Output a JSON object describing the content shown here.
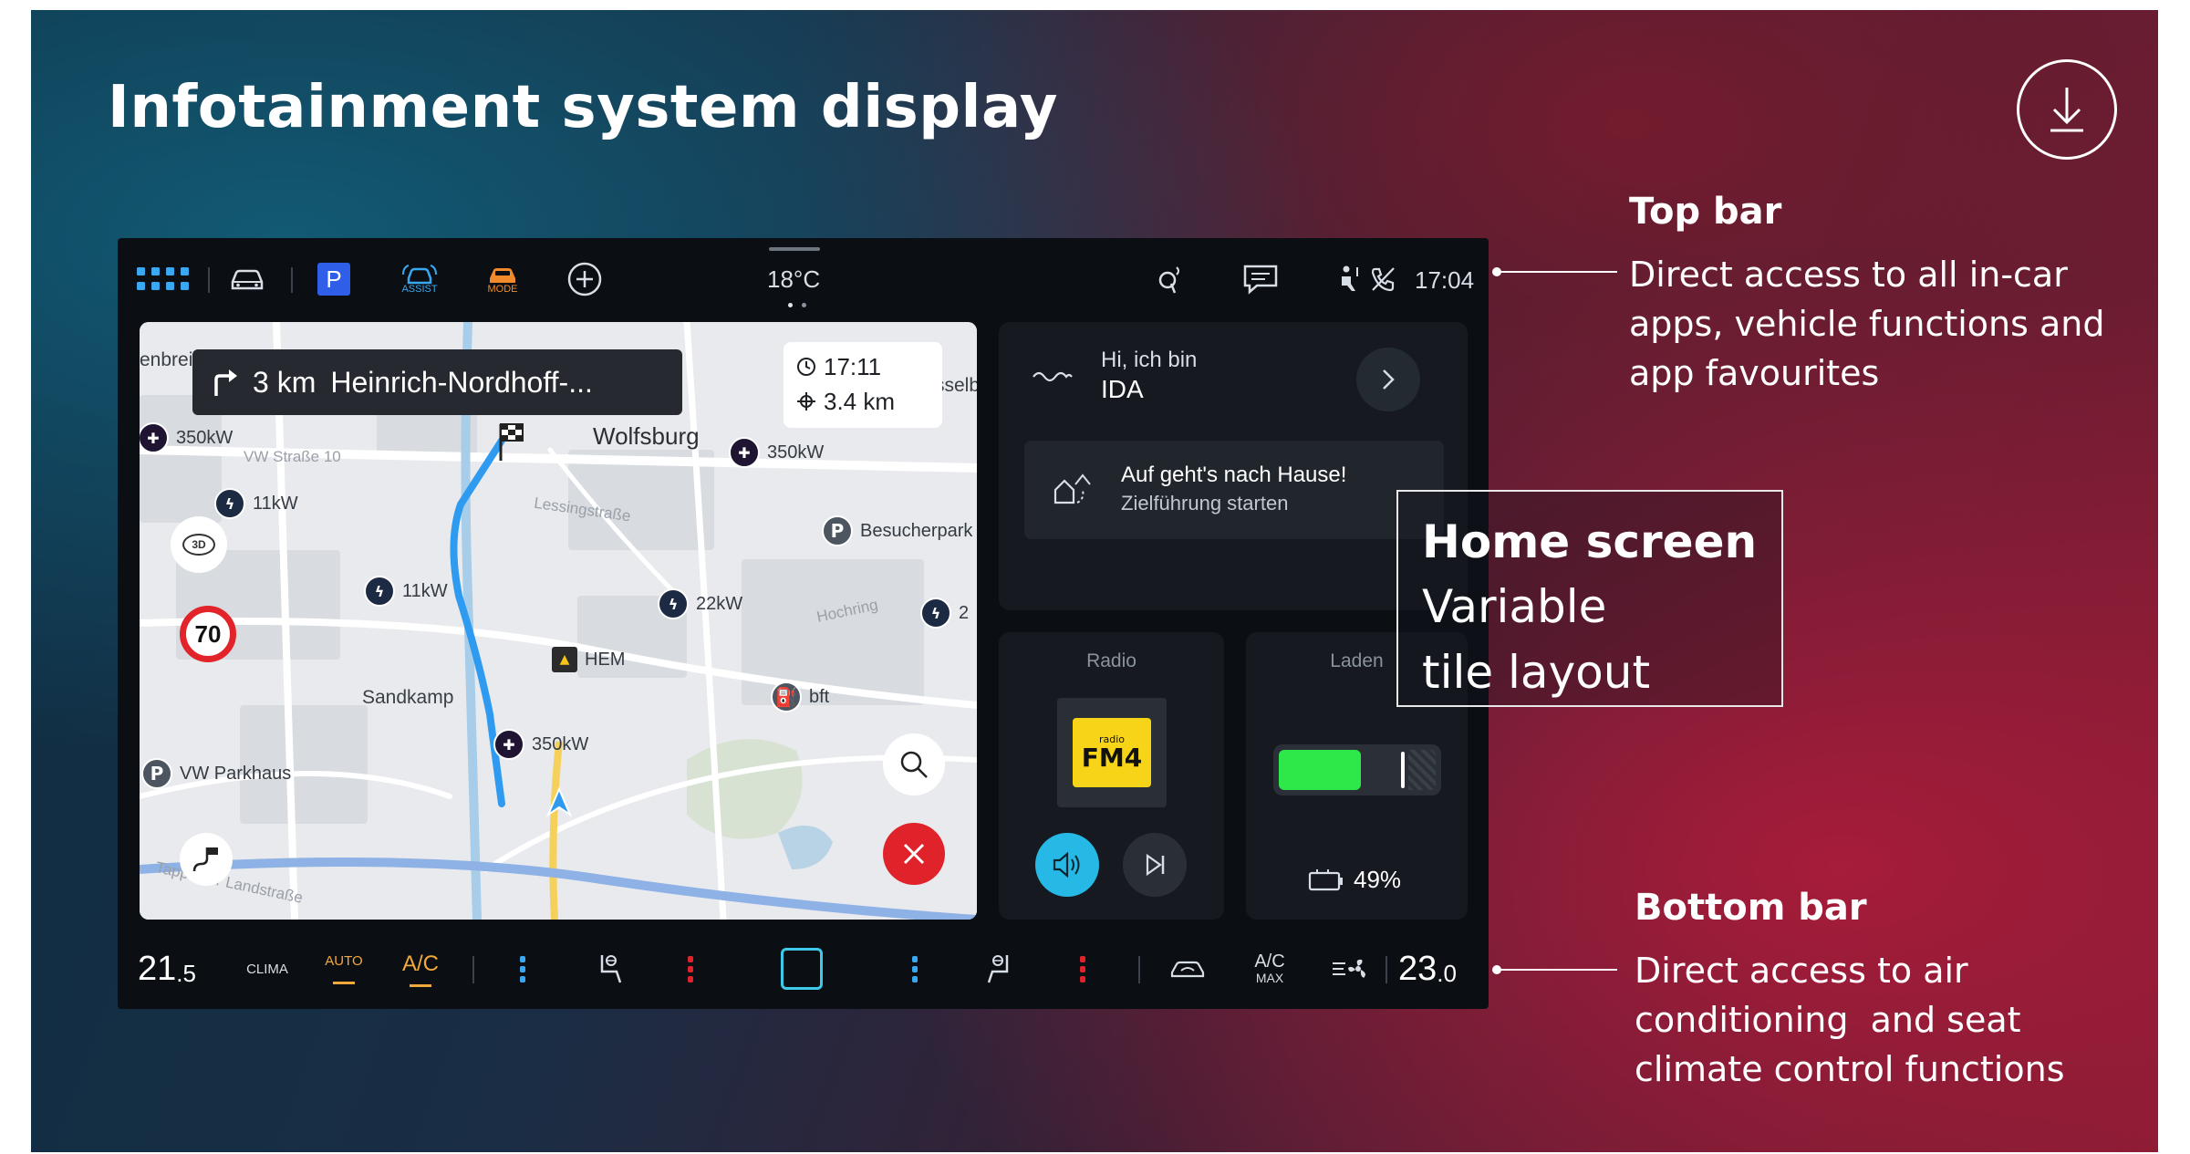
{
  "slide": {
    "title": "Infotainment system display",
    "download_icon": "download-icon"
  },
  "annotations": {
    "top_bar": {
      "title": "Top bar",
      "lines": [
        "Direct access to all in-car",
        "apps, vehicle functions and",
        "app favourites"
      ]
    },
    "home_screen": {
      "title": "Home screen",
      "lines": [
        "Variable",
        "tile layout"
      ]
    },
    "bottom_bar": {
      "title": "Bottom bar",
      "lines": [
        "Direct access to air",
        "conditioning  and seat",
        "climate control functions"
      ]
    }
  },
  "top_bar": {
    "items": [
      "apps-grid-icon",
      "car-icon",
      "parking-icon",
      "assist-icon",
      "mode-icon",
      "add-icon"
    ],
    "parking_label": "P",
    "assist_label": "ASSIST",
    "mode_label": "MODE",
    "temperature": "18°C",
    "right_icons": [
      "wireless-charge-icon",
      "messages-icon",
      "seatbelt-icon",
      "phone-off-icon"
    ],
    "time": "17:04"
  },
  "map": {
    "instruction_distance": "3 km",
    "instruction_street": "Heinrich-Nordhoff-...",
    "eta_time": "17:11",
    "eta_distance": "3.4 km",
    "speed_limit": "70",
    "view_mode": "3D",
    "labels": {
      "wolfsburg": "Wolfsburg",
      "sandkamp": "Sandkamp",
      "enbreite": "enbreite",
      "lessingstrasse": "Lessingstraße",
      "hochring": "Hochring",
      "vw_strasse": "VW Straße 10",
      "landstrasse": "Tapp  cker Landstraße",
      "zzkw": "22kW",
      "selb": "sselb"
    },
    "pois": [
      {
        "type": "fast",
        "label": "350kW"
      },
      {
        "type": "fast",
        "label": "350kW"
      },
      {
        "type": "charge",
        "label": "11kW"
      },
      {
        "type": "charge",
        "label": "11kW"
      },
      {
        "type": "charge",
        "label": "22kW"
      },
      {
        "type": "fast",
        "label": "350kW"
      },
      {
        "type": "park",
        "label": "Besucherpark"
      },
      {
        "type": "park",
        "label": "VW Parkhaus"
      },
      {
        "type": "fuel",
        "label": "bft"
      },
      {
        "type": "hem",
        "label": "HEM"
      },
      {
        "type": "charge",
        "label": "2"
      }
    ]
  },
  "ida_tile": {
    "greeting": "Hi, ich bin",
    "name": "IDA",
    "card_title": "Auf geht's nach Hause!",
    "card_subtitle": "Zielführung starten"
  },
  "radio_tile": {
    "title": "Radio",
    "station_line1": "radio",
    "station_line2": "FM4"
  },
  "charge_tile": {
    "title": "Laden",
    "battery_percent_label": "49%",
    "battery_level": 0.49,
    "bar_color": "#2ee84a"
  },
  "bottom_bar": {
    "left_temp_main": "21",
    "left_temp_dec": ".5",
    "clima": "CLIMA",
    "auto": "AUTO",
    "ac": "A/C",
    "ac_max_top": "A/C",
    "ac_max_bottom": "MAX",
    "right_temp_main": "23",
    "right_temp_dec": ".0",
    "accent_color": "#f2a93b"
  }
}
